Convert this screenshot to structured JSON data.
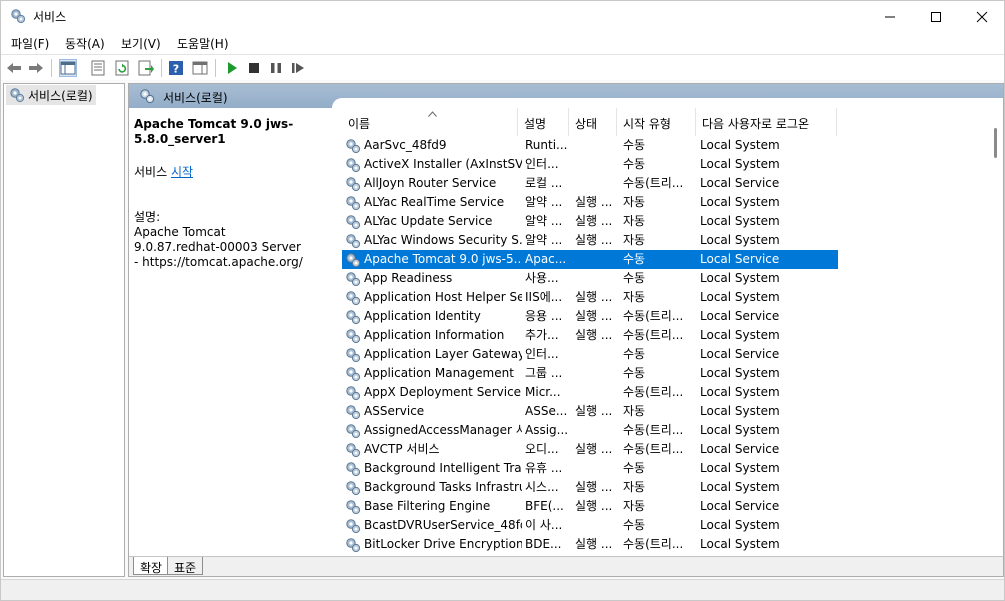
{
  "window": {
    "title": "서비스"
  },
  "menu": [
    {
      "label": "파일(F)"
    },
    {
      "label": "동작(A)"
    },
    {
      "label": "보기(V)"
    },
    {
      "label": "도움말(H)"
    }
  ],
  "tree": {
    "root_label": "서비스(로컬)"
  },
  "pane_header": {
    "title": "서비스(로컬)"
  },
  "description": {
    "service_name": "Apache Tomcat 9.0 jws-5.8.0_server1",
    "action_prefix": "서비스",
    "action_link": "시작",
    "desc_label": "설명:",
    "desc_text": "Apache Tomcat 9.0.87.redhat-00003 Server - https://tomcat.apache.org/"
  },
  "columns": [
    {
      "label": "이름"
    },
    {
      "label": "설명"
    },
    {
      "label": "상태"
    },
    {
      "label": "시작 유형"
    },
    {
      "label": "다음 사용자로 로그온"
    }
  ],
  "services": [
    {
      "name": "AarSvc_48fd9",
      "desc": "Runti...",
      "status": "",
      "startup": "수동",
      "logon": "Local System"
    },
    {
      "name": "ActiveX Installer (AxInstSV)",
      "desc": "인터...",
      "status": "",
      "startup": "수동",
      "logon": "Local System"
    },
    {
      "name": "AllJoyn Router Service",
      "desc": "로컬 ...",
      "status": "",
      "startup": "수동(트리...",
      "logon": "Local Service"
    },
    {
      "name": "ALYac RealTime Service",
      "desc": "알약 ...",
      "status": "실행 ...",
      "startup": "자동",
      "logon": "Local System"
    },
    {
      "name": "ALYac Update Service",
      "desc": "알약 ...",
      "status": "실행 ...",
      "startup": "자동",
      "logon": "Local System"
    },
    {
      "name": "ALYac Windows Security S...",
      "desc": "알약 ...",
      "status": "실행 ...",
      "startup": "자동",
      "logon": "Local System"
    },
    {
      "name": "Apache Tomcat 9.0 jws-5....",
      "desc": "Apac...",
      "status": "",
      "startup": "수동",
      "logon": "Local Service",
      "selected": true
    },
    {
      "name": "App Readiness",
      "desc": "사용...",
      "status": "",
      "startup": "수동",
      "logon": "Local System"
    },
    {
      "name": "Application Host Helper Se...",
      "desc": "IIS에...",
      "status": "실행 ...",
      "startup": "자동",
      "logon": "Local System"
    },
    {
      "name": "Application Identity",
      "desc": "응용 ...",
      "status": "실행 ...",
      "startup": "수동(트리...",
      "logon": "Local Service"
    },
    {
      "name": "Application Information",
      "desc": "추가...",
      "status": "실행 ...",
      "startup": "수동(트리...",
      "logon": "Local System"
    },
    {
      "name": "Application Layer Gateway ...",
      "desc": "인터...",
      "status": "",
      "startup": "수동",
      "logon": "Local Service"
    },
    {
      "name": "Application Management",
      "desc": "그룹 ...",
      "status": "",
      "startup": "수동",
      "logon": "Local System"
    },
    {
      "name": "AppX Deployment Service ...",
      "desc": "Micr...",
      "status": "",
      "startup": "수동(트리...",
      "logon": "Local System"
    },
    {
      "name": "ASService",
      "desc": "ASSe...",
      "status": "실행 ...",
      "startup": "자동",
      "logon": "Local System"
    },
    {
      "name": "AssignedAccessManager 서...",
      "desc": "Assig...",
      "status": "",
      "startup": "수동(트리...",
      "logon": "Local System"
    },
    {
      "name": "AVCTP 서비스",
      "desc": "오디...",
      "status": "실행 ...",
      "startup": "수동(트리...",
      "logon": "Local Service"
    },
    {
      "name": "Background Intelligent Tra...",
      "desc": "유휴 ...",
      "status": "",
      "startup": "수동",
      "logon": "Local System"
    },
    {
      "name": "Background Tasks Infrastru...",
      "desc": "시스...",
      "status": "실행 ...",
      "startup": "자동",
      "logon": "Local System"
    },
    {
      "name": "Base Filtering Engine",
      "desc": "BFE(...",
      "status": "실행 ...",
      "startup": "자동",
      "logon": "Local Service"
    },
    {
      "name": "BcastDVRUserService_48fd9",
      "desc": "이 사...",
      "status": "",
      "startup": "수동",
      "logon": "Local System"
    },
    {
      "name": "BitLocker Drive Encryption ...",
      "desc": "BDE...",
      "status": "실행 ...",
      "startup": "수동(트리...",
      "logon": "Local System"
    }
  ],
  "bottom_tabs": [
    {
      "label": "확장",
      "active": true
    },
    {
      "label": "표준",
      "active": false
    }
  ]
}
